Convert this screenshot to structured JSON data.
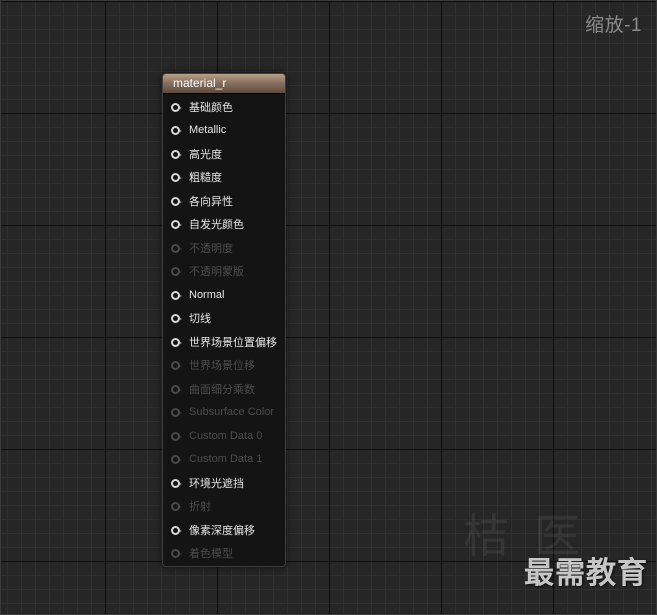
{
  "zoom_label": "缩放-1",
  "node": {
    "title": "material_r",
    "pins": [
      {
        "label": "基础颜色",
        "enabled": true
      },
      {
        "label": "Metallic",
        "enabled": true
      },
      {
        "label": "高光度",
        "enabled": true
      },
      {
        "label": "粗糙度",
        "enabled": true
      },
      {
        "label": "各向异性",
        "enabled": true
      },
      {
        "label": "自发光颜色",
        "enabled": true
      },
      {
        "label": "不透明度",
        "enabled": false
      },
      {
        "label": "不透明蒙版",
        "enabled": false
      },
      {
        "label": "Normal",
        "enabled": true
      },
      {
        "label": "切线",
        "enabled": true
      },
      {
        "label": "世界场景位置偏移",
        "enabled": true
      },
      {
        "label": "世界场景位移",
        "enabled": false
      },
      {
        "label": "曲面细分乘数",
        "enabled": false
      },
      {
        "label": "Subsurface Color",
        "enabled": false
      },
      {
        "label": "Custom Data 0",
        "enabled": false
      },
      {
        "label": "Custom Data 1",
        "enabled": false
      },
      {
        "label": "环境光遮挡",
        "enabled": true
      },
      {
        "label": "折射",
        "enabled": false
      },
      {
        "label": "像素深度偏移",
        "enabled": true
      },
      {
        "label": "着色模型",
        "enabled": false
      }
    ]
  },
  "watermark": {
    "text": "最需教育",
    "ghost_text": "桔 医"
  },
  "colors": {
    "enabled_pin": "#e6e6e6",
    "disabled_pin": "#4d4d4d",
    "header": "#8a7260",
    "background": "#262626"
  }
}
